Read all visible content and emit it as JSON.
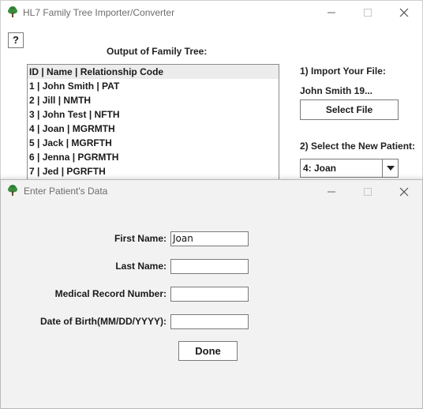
{
  "main_window": {
    "title": "HL7 Family Tree Importer/Converter",
    "help_label": "?",
    "output_label": "Output of Family Tree:",
    "list_items": [
      "ID | Name | Relationship Code",
      "1 | John Smith | PAT",
      "2 | Jill  | NMTH",
      "3 | John Test | NFTH",
      "4 | Joan  | MGRMTH",
      "5 | Jack  | MGRFTH",
      "6 | Jenna  | PGRMTH",
      "7 | Jed  | PGRFTH"
    ],
    "import_label": "1) Import Your File:",
    "file_name": "John Smith 19...",
    "select_file_label": "Select File",
    "select_patient_label": "2) Select the New Patient:",
    "patient_selected": "4: Joan"
  },
  "dialog": {
    "title": "Enter Patient's Data",
    "fields": [
      {
        "label": "First Name:",
        "value": "Joan"
      },
      {
        "label": "Last Name:",
        "value": ""
      },
      {
        "label": "Medical Record Number:",
        "value": ""
      },
      {
        "label": "Date of Birth(MM/DD/YYYY):",
        "value": ""
      }
    ],
    "done_label": "Done"
  },
  "colors": {
    "tree_icon": "#2e7d32",
    "trunk": "#6d4c2f",
    "title_text": "#6d6d6d",
    "dialog_bg": "#f2f2f2"
  }
}
